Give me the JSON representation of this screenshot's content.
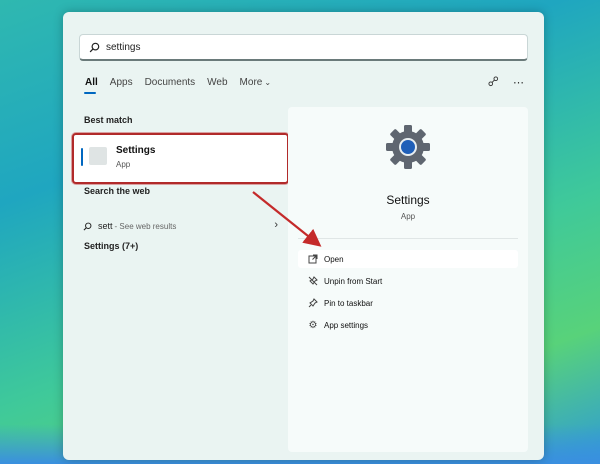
{
  "search": {
    "value": "settings"
  },
  "tabs": [
    {
      "label": "All"
    },
    {
      "label": "Apps"
    },
    {
      "label": "Documents"
    },
    {
      "label": "Web"
    },
    {
      "label": "More"
    }
  ],
  "left": {
    "best_match_heading": "Best match",
    "best_match": {
      "name": "Settings",
      "type": "App"
    },
    "search_web_heading": "Search the web",
    "web_result": {
      "query": "sett",
      "suffix": "- See web results"
    },
    "settings_count_heading": "Settings (7+)"
  },
  "preview": {
    "title": "Settings",
    "subtitle": "App",
    "actions": [
      {
        "label": "Open",
        "icon": "open-external-icon"
      },
      {
        "label": "Unpin from Start",
        "icon": "unpin-icon"
      },
      {
        "label": "Pin to taskbar",
        "icon": "pin-icon"
      },
      {
        "label": "App settings",
        "icon": "gear-icon"
      }
    ]
  },
  "colors": {
    "accent": "#0067c0",
    "highlight": "#b12a2a"
  }
}
